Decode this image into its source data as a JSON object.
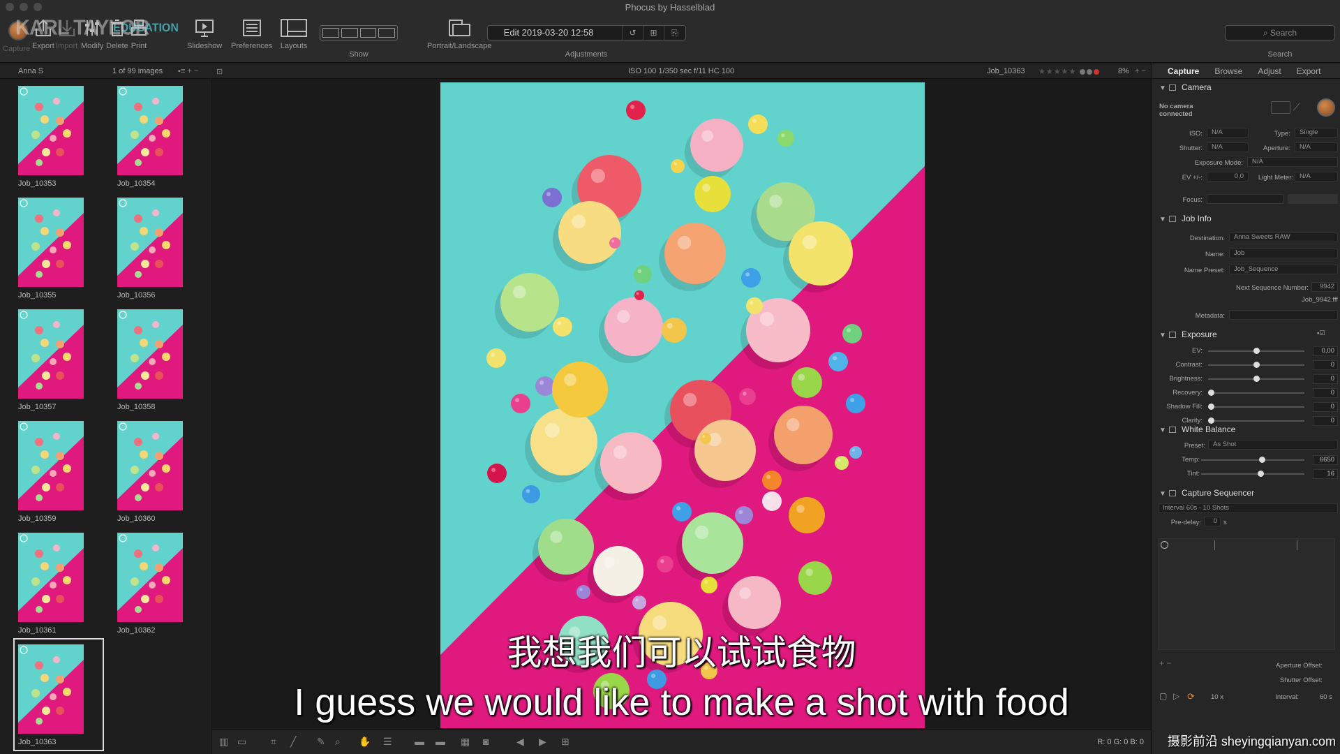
{
  "window": {
    "title": "Phocus by Hasselblad"
  },
  "brand": {
    "name": "KARL TAYLOR",
    "sub": "EDUCATION"
  },
  "toolbar": {
    "items": [
      {
        "label": "Capture",
        "icon": "capture-knob-icon",
        "enabled": false
      },
      {
        "label": "Export",
        "icon": "export-icon",
        "enabled": true
      },
      {
        "label": "Import",
        "icon": "import-icon",
        "enabled": false
      },
      {
        "label": "Modify",
        "icon": "modify-icon",
        "enabled": true
      },
      {
        "label": "Delete",
        "icon": "delete-icon",
        "enabled": true
      },
      {
        "label": "Print",
        "icon": "print-icon",
        "enabled": true
      },
      {
        "label": "Slideshow",
        "icon": "slideshow-icon",
        "enabled": true
      },
      {
        "label": "Preferences",
        "icon": "preferences-icon",
        "enabled": true
      },
      {
        "label": "Layouts",
        "icon": "layouts-icon",
        "enabled": true
      },
      {
        "label": "Show",
        "icon": "show-icon",
        "enabled": true
      },
      {
        "label": "Portrait/Landscape",
        "icon": "portrait-landscape-icon",
        "enabled": true
      }
    ],
    "edit_date": "Edit 2019-03-20 12:58",
    "adjustments_label": "Adjustments",
    "search_placeholder": "Search",
    "search_label": "Search"
  },
  "subbar": {
    "folder": "Anna S",
    "count": "1 of 99 images",
    "exif": "ISO 100  1/350 sec  f/11  HC 100",
    "current_name": "Job_10363",
    "zoom": "8%"
  },
  "browser": {
    "thumbnails": [
      {
        "name": "Job_10353"
      },
      {
        "name": "Job_10354"
      },
      {
        "name": "Job_10355"
      },
      {
        "name": "Job_10356"
      },
      {
        "name": "Job_10357"
      },
      {
        "name": "Job_10358"
      },
      {
        "name": "Job_10359"
      },
      {
        "name": "Job_10360"
      },
      {
        "name": "Job_10361"
      },
      {
        "name": "Job_10362"
      },
      {
        "name": "Job_10363",
        "selected": true
      }
    ]
  },
  "panel": {
    "tabs": [
      "Capture",
      "Browse",
      "Adjust",
      "Export"
    ],
    "active_tab": "Capture",
    "camera": {
      "title": "Camera",
      "status": "No camera connected",
      "iso_label": "ISO:",
      "iso": "N/A",
      "type_label": "Type:",
      "type": "Single",
      "shutter_label": "Shutter:",
      "shutter": "N/A",
      "aperture_label": "Aperture:",
      "aperture": "N/A",
      "exposure_mode_label": "Exposure Mode:",
      "exposure_mode": "N/A",
      "ev_label": "EV +/-:",
      "ev": "0,0",
      "light_meter_label": "Light Meter:",
      "light_meter": "N/A",
      "focus_label": "Focus:"
    },
    "job_info": {
      "title": "Job Info",
      "destination_label": "Destination:",
      "destination": "Anna Sweets RAW",
      "name_label": "Name:",
      "name": "Job",
      "name_preset_label": "Name Preset:",
      "name_preset": "Job_Sequence",
      "next_seq_label": "Next Sequence Number:",
      "next_seq": "9942",
      "next_file": "Job_9942.fff",
      "metadata_label": "Metadata:"
    },
    "exposure": {
      "title": "Exposure",
      "sliders": [
        {
          "label": "EV:",
          "value": "0,00",
          "pos": 0.5
        },
        {
          "label": "Contrast:",
          "value": "0",
          "pos": 0.5
        },
        {
          "label": "Brightness:",
          "value": "0",
          "pos": 0.5
        },
        {
          "label": "Recovery:",
          "value": "0",
          "pos": 0.0
        },
        {
          "label": "Shadow Fill:",
          "value": "0",
          "pos": 0.0
        },
        {
          "label": "Clarity:",
          "value": "0",
          "pos": 0.0
        }
      ]
    },
    "white_balance": {
      "title": "White Balance",
      "preset_label": "Preset:",
      "preset": "As Shot",
      "sliders": [
        {
          "label": "Temp:",
          "value": "6650",
          "pos": 0.6
        },
        {
          "label": "Tint:",
          "value": "16",
          "pos": 0.58
        }
      ]
    },
    "sequencer": {
      "title": "Capture Sequencer",
      "preset": "Interval 60s - 10 Shots",
      "predelay_label": "Pre-delay:",
      "predelay": "0",
      "predelay_unit": "s",
      "aperture_offset_label": "Aperture Offset:",
      "shutter_offset_label": "Shutter Offset:",
      "count": "10",
      "count_unit": "x",
      "interval_label": "Interval:",
      "interval": "60",
      "interval_unit": "s"
    }
  },
  "viewer": {
    "rgb": "R:    0  G:    0  B:    0"
  },
  "subtitles": {
    "cn": "我想我们可以试试食物",
    "en": "I guess we would like to make a shot with food"
  },
  "watermark": "摄影前沿 sheyingqianyan.com",
  "colors": {
    "teal": "#62d3cc",
    "magenta": "#e0197e",
    "accent": "#d2894c"
  }
}
